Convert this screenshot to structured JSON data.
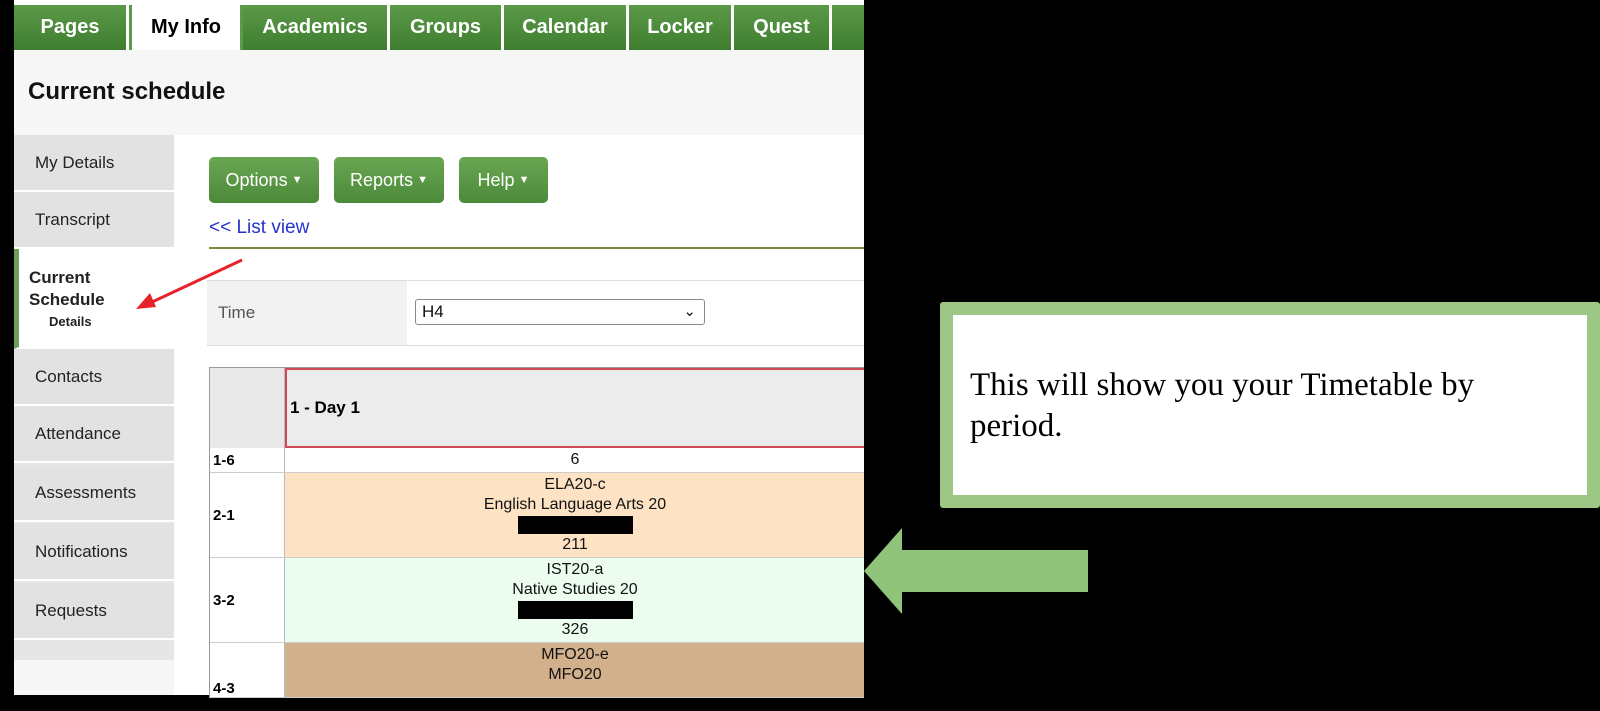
{
  "top_tabs": [
    {
      "label": "Pages"
    },
    {
      "label": "My Info",
      "active": true
    },
    {
      "label": "Academics"
    },
    {
      "label": "Groups"
    },
    {
      "label": "Calendar"
    },
    {
      "label": "Locker"
    },
    {
      "label": "Quest"
    }
  ],
  "page_title": "Current schedule",
  "sidebar": {
    "items": [
      {
        "label": "My Details"
      },
      {
        "label": "Transcript"
      },
      {
        "label": "Current Schedule",
        "sub": "Details",
        "active": true
      },
      {
        "label": "Contacts"
      },
      {
        "label": "Attendance"
      },
      {
        "label": "Assessments"
      },
      {
        "label": "Notifications"
      },
      {
        "label": "Requests"
      }
    ]
  },
  "toolbar": {
    "options": "Options",
    "reports": "Reports",
    "help": "Help"
  },
  "list_view_link": "<< List view",
  "time_filter": {
    "label": "Time",
    "value": "H4"
  },
  "schedule": {
    "day_header": "1 - Day 1",
    "rows": [
      {
        "period": "1-6",
        "lines": [
          "6"
        ]
      },
      {
        "period": "2-1",
        "lines": [
          "ELA20-c",
          "English Language Arts 20"
        ],
        "room": "211",
        "color": "#fde3c3"
      },
      {
        "period": "3-2",
        "lines": [
          "IST20-a",
          "Native Studies 20"
        ],
        "room": "326",
        "color": "#ecfcef"
      },
      {
        "period": "4-3",
        "lines": [
          "MFO20-e",
          "MFO20"
        ],
        "color": "#d2b08c"
      }
    ]
  },
  "callout": {
    "text": "This will show you your Timetable by period.",
    "border_color": "#9cc785"
  },
  "colors": {
    "tab_green": "#4b8a3a",
    "annotation_red": "#e8222a"
  }
}
